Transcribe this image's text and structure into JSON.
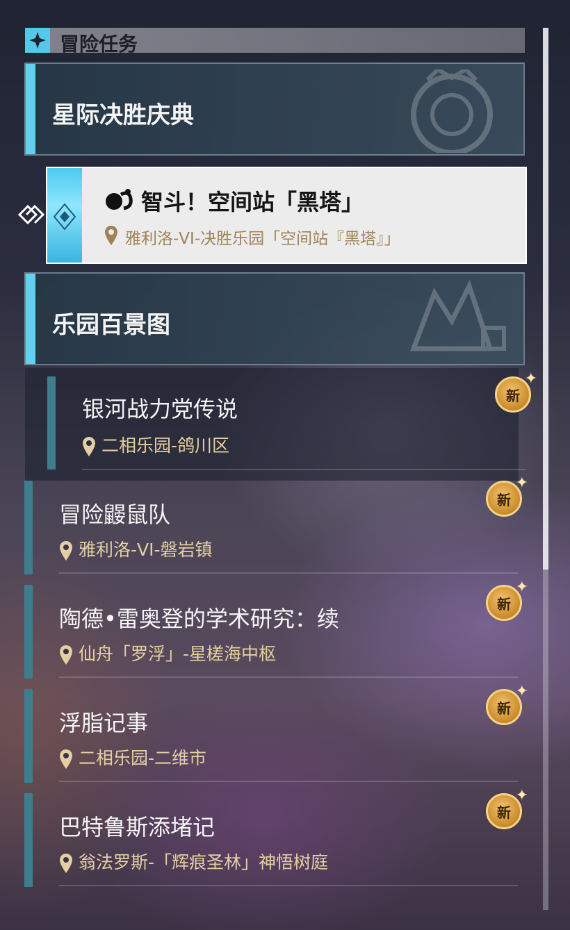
{
  "header": {
    "title": "冒险任务",
    "icon": "sparkle-icon"
  },
  "categories": [
    {
      "title": "星际决胜庆典"
    },
    {
      "title": "乐园百景图"
    }
  ],
  "selected_quest": {
    "title": "智斗！空间站「黑塔」",
    "location": "雅利洛-VI-决胜乐园「空间站『黑塔』」"
  },
  "quests": [
    {
      "title": "银河战力党传说",
      "location": "二相乐园-鸽川区",
      "badge": "新"
    },
    {
      "title": "冒险鼹鼠队",
      "location": "雅利洛-VI-磐岩镇",
      "badge": "新"
    },
    {
      "title": "陶德•雷奥登的学术研究：续",
      "location": "仙舟「罗浮」-星槎海中枢",
      "badge": "新"
    },
    {
      "title": "浮脂记事",
      "location": "二相乐园-二维市",
      "badge": "新"
    },
    {
      "title": "巴特鲁斯添堵记",
      "location": "翁法罗斯-「辉痕圣林」神悟树庭",
      "badge": "新"
    }
  ],
  "colors": {
    "accent": "#5fd3ee",
    "location_text": "#e5cfa2",
    "badge": "#d99a3a"
  }
}
